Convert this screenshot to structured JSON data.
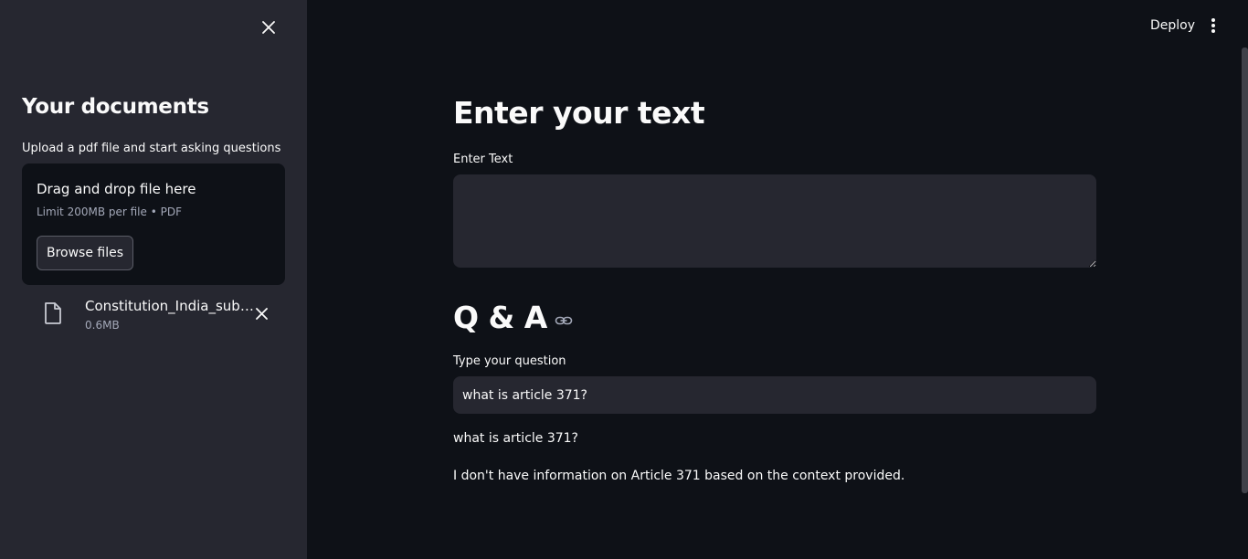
{
  "sidebar": {
    "title": "Your documents",
    "uploader": {
      "label": "Upload a pdf file and start asking questions",
      "drop_text": "Drag and drop file here",
      "limit_text": "Limit 200MB per file • PDF",
      "browse_label": "Browse files"
    },
    "file": {
      "name": "Constitution_India_subset.pdf",
      "size": "0.6MB",
      "icon": "file-icon"
    }
  },
  "header": {
    "deploy_label": "Deploy",
    "menu_icon": "more-vertical-icon"
  },
  "main": {
    "title": "Enter your text",
    "text_input": {
      "label": "Enter Text",
      "value": ""
    },
    "qa": {
      "heading": "Q & A",
      "question_label": "Type your question",
      "question_value": "what is article 371?",
      "echo": "what is article 371?",
      "answer": "I don't have information on Article 371 based on the context provided."
    }
  },
  "colors": {
    "background": "#0e1117",
    "sidebar": "#262730",
    "input_bg": "#262730",
    "text": "#fafafa",
    "muted_text": "#a3a8b8"
  }
}
